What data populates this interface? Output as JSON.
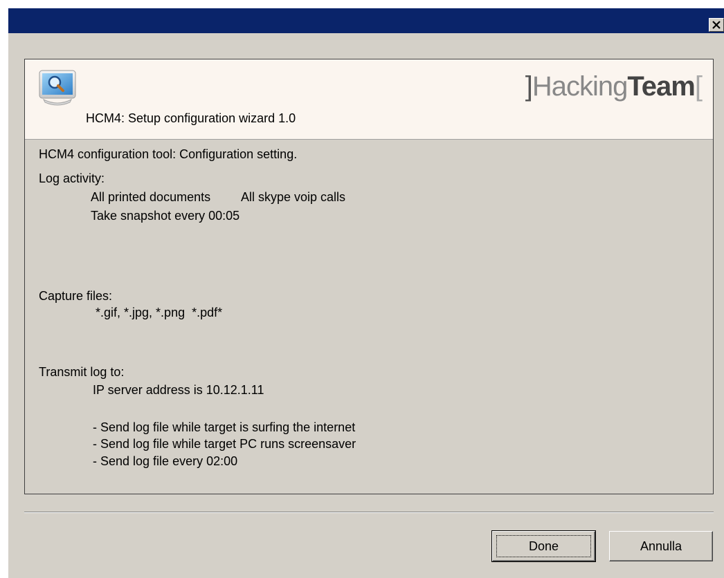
{
  "window": {
    "close_glyph": "×"
  },
  "header": {
    "brand_open": "]",
    "brand_hacking": "Hacking",
    "brand_team": "Team",
    "brand_close": "[",
    "title": "HCM4: Setup configuration wizard 1.0",
    "icon": "monitor-magnifier-icon"
  },
  "content": {
    "intro": "HCM4 configuration tool: Configuration setting.",
    "log_activity_label": "Log activity:",
    "log_item_printed": "All printed documents",
    "log_item_skype": "All skype voip calls",
    "log_item_snapshot": "Take snapshot every 00:05",
    "capture_label": "Capture files:",
    "capture_value": "*.gif, *.jpg, *.png  *.pdf*",
    "transmit_label": "Transmit log to:",
    "transmit_ip": "IP server address is 10.12.1.11",
    "transmit_rule_1": "- Send log file while target is surfing the internet",
    "transmit_rule_2": "- Send log file while target PC runs screensaver",
    "transmit_rule_3": "- Send log file every 02:00"
  },
  "buttons": {
    "done": "Done",
    "cancel": "Annulla"
  },
  "colors": {
    "titlebar": "#0a246a",
    "dialog_bg": "#d4d0c8",
    "header_bg": "#fbf5ef"
  }
}
